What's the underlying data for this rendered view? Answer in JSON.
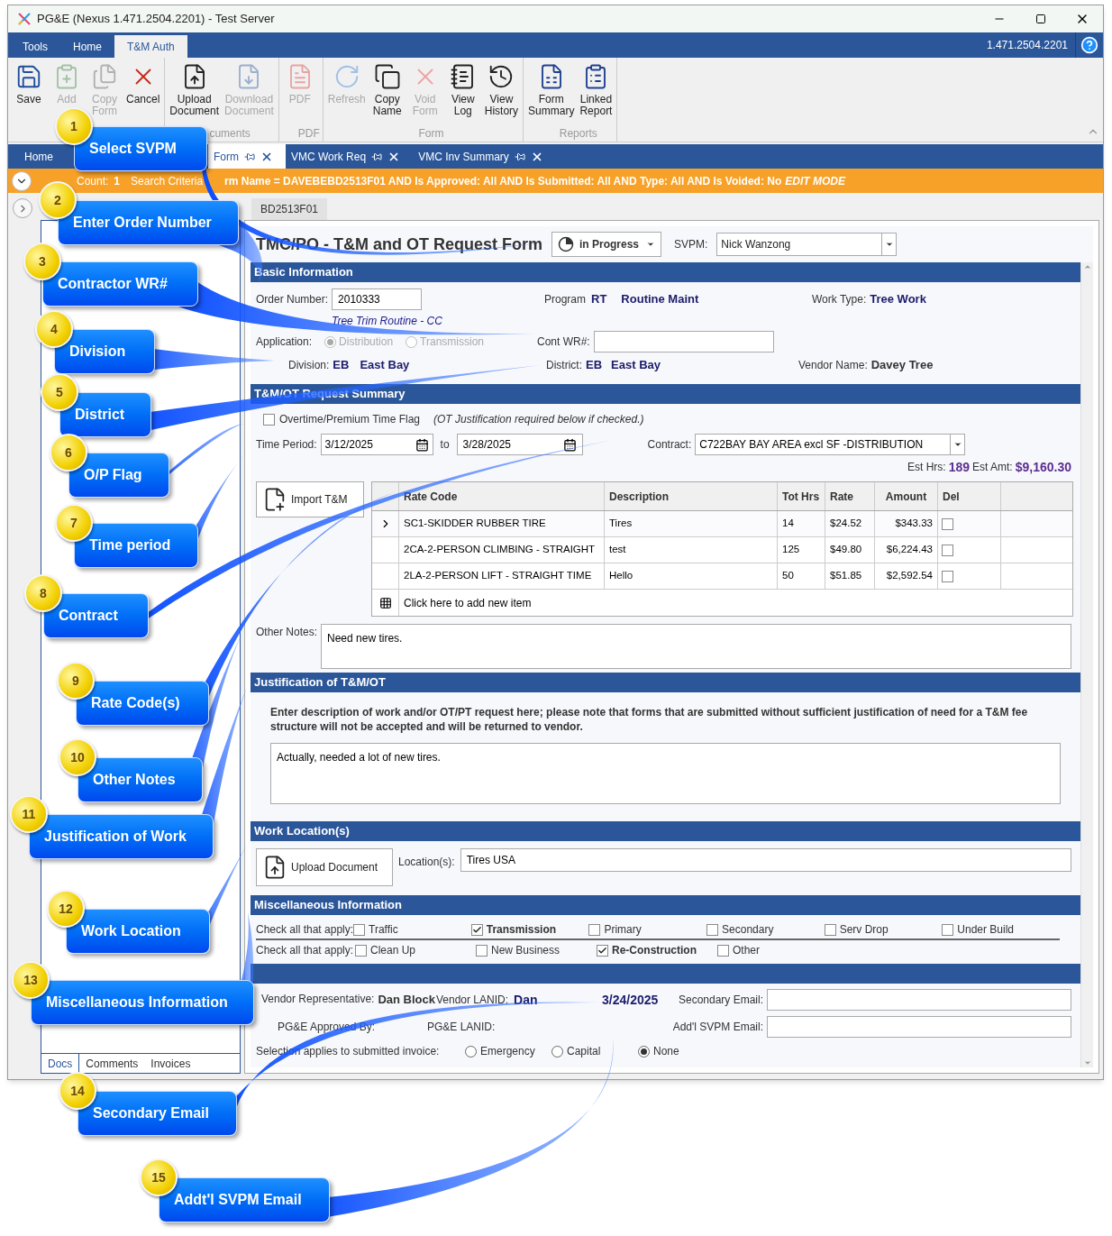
{
  "window": {
    "title": "PG&E (Nexus 1.471.2504.2201) - Test Server"
  },
  "menu_tabs": [
    {
      "label": "Tools",
      "selected": false
    },
    {
      "label": "Home",
      "selected": false
    },
    {
      "label": "T&M Auth",
      "selected": true
    }
  ],
  "version": "1.471.2504.2201",
  "ribbon_groups": [
    {
      "buttons": [
        {
          "kind": "save",
          "label": "Save",
          "disabled": false
        },
        {
          "kind": "add",
          "label": "Add",
          "disabled": true
        },
        {
          "kind": "copy-form",
          "label": "Copy Form",
          "disabled": true
        },
        {
          "kind": "cancel",
          "label": "Cancel",
          "disabled": false
        }
      ]
    },
    {
      "label": "cuments",
      "buttons": [
        {
          "kind": "upload",
          "label": "Upload Document",
          "disabled": false
        },
        {
          "kind": "download",
          "label": "Download Document",
          "disabled": true
        }
      ]
    },
    {
      "label": "PDF",
      "buttons": [
        {
          "kind": "pdf",
          "label": "PDF",
          "disabled": true
        }
      ]
    },
    {
      "label": "Form",
      "buttons": [
        {
          "kind": "refresh",
          "label": "Refresh",
          "disabled": true
        },
        {
          "kind": "copy-name",
          "label": "Copy Name",
          "disabled": false
        },
        {
          "kind": "void",
          "label": "Void Form",
          "disabled": true
        },
        {
          "kind": "log",
          "label": "View Log",
          "disabled": false
        },
        {
          "kind": "history",
          "label": "View History",
          "disabled": false
        }
      ]
    },
    {
      "label": "Reports",
      "buttons": [
        {
          "kind": "summary",
          "label": "Form Summary",
          "disabled": false
        },
        {
          "kind": "report",
          "label": "Linked Report",
          "disabled": false
        }
      ]
    }
  ],
  "doc_tabs": [
    {
      "label": "Home",
      "selected": false,
      "closable": false
    },
    {
      "label": "Form",
      "selected": true,
      "closable": true
    },
    {
      "label": "VMC Work Req",
      "selected": false,
      "closable": true
    },
    {
      "label": "VMC Inv Summary",
      "selected": false,
      "closable": true
    }
  ],
  "filter_bar": {
    "count_label": "Count:",
    "count": "1",
    "criteria_label": "Search Criteria",
    "criteria": "rm Name = DAVEBEBD2513F01 AND Is Approved: All AND Is Submitted: All AND Type: All AND Is Voided: No",
    "mode": "EDIT MODE"
  },
  "side_tabs": [
    {
      "label": "Docs",
      "selected": true
    },
    {
      "label": "Comments",
      "selected": false
    },
    {
      "label": "Invoices",
      "selected": false
    }
  ],
  "form_tab": "BD2513F01",
  "form": {
    "title": "TMC/PO - T&M and OT Request Form",
    "status": "in Progress",
    "svpm_label": "SVPM:",
    "svpm": "Nick Wanzong",
    "basic": {
      "heading": "Basic Information",
      "order_label": "Order Number:",
      "order": "2010333",
      "order_desc": "Tree Trim Routine - CC",
      "program_label": "Program",
      "program_code": "RT",
      "program_name": "Routine Maint",
      "work_type_label": "Work Type:",
      "work_type": "Tree Work",
      "application_label": "Application:",
      "applications": [
        {
          "label": "Distribution",
          "selected": true
        },
        {
          "label": "Transmission",
          "selected": false
        }
      ],
      "cont_wr_label": "Cont WR#:",
      "division_label": "Division:",
      "division_code": "EB",
      "division_name": "East Bay",
      "district_label": "District:",
      "district_code": "EB",
      "district_name": "East Bay",
      "vendor_label": "Vendor Name:",
      "vendor": "Davey Tree"
    },
    "summary": {
      "heading": "T&M/OT Request Summary",
      "ot_flag": {
        "label": "Overtime/Premium Time Flag",
        "checked": false
      },
      "ot_note": "(OT Justification required below if checked.)",
      "time_label": "Time Period:",
      "from": "3/12/2025",
      "to_label": "to",
      "to": "3/28/2025",
      "contract_label": "Contract:",
      "contract": "C722BAY BAY AREA excl SF -DISTRIBUTION",
      "hrs_label": "Est Hrs:",
      "hrs": "189",
      "amt_label": "Est Amt:",
      "amt": "$9,160.30",
      "import_label": "Import T&M",
      "columns": [
        "Rate Code",
        "Description",
        "Tot Hrs",
        "Rate",
        "Amount",
        "Del"
      ],
      "rows": [
        {
          "selected": true,
          "cells": [
            "SC1-SKIDDER RUBBER TIRE",
            "Tires",
            "14",
            "$24.52",
            "$343.33"
          ],
          "del": false
        },
        {
          "selected": false,
          "cells": [
            "2CA-2-PERSON CLIMBING - STRAIGHT",
            "test",
            "125",
            "$49.80",
            "$6,224.43"
          ],
          "del": false
        },
        {
          "selected": false,
          "cells": [
            "2LA-2-PERSON LIFT - STRAIGHT TIME",
            "Hello",
            "50",
            "$51.85",
            "$2,592.54"
          ],
          "del": false
        }
      ],
      "add_row": "Click here to add new item",
      "notes_label": "Other Notes:",
      "notes": "Need new tires."
    },
    "justification": {
      "heading": "Justification of T&M/OT",
      "instructions": "Enter description of work and/or OT/PT request here; please note that forms that are submitted without sufficient justification of need for a T&M fee structure will not be accepted and will be returned to vendor.",
      "text": "Actually, needed a lot of new tires."
    },
    "location": {
      "heading": "Work Location(s)",
      "upload_label": "Upload Document",
      "locations_label": "Location(s):",
      "locations": "Tires USA"
    },
    "misc": {
      "heading": "Miscellaneous Information",
      "rows": [
        {
          "label": "Check all that apply:",
          "items": [
            {
              "label": "Traffic",
              "checked": false
            },
            {
              "label": "Transmission",
              "checked": true
            },
            {
              "label": "Primary",
              "checked": false
            },
            {
              "label": "Secondary",
              "checked": false
            },
            {
              "label": "Serv Drop",
              "checked": false
            },
            {
              "label": "Under Build",
              "checked": false
            }
          ]
        },
        {
          "label": "Check all that apply:",
          "items": [
            {
              "label": "Clean Up",
              "checked": false
            },
            {
              "label": "New Business",
              "checked": false
            },
            {
              "label": "Re-Construction",
              "checked": true
            },
            {
              "label": "Other",
              "checked": false
            }
          ]
        }
      ]
    },
    "approval": {
      "vendor_rep_label": "Vendor Representative:",
      "vendor_rep": "Dan Block",
      "vendor_lanid_label": "Vendor LANID:",
      "vendor_lanid": "Dan",
      "date": "3/24/2025",
      "secondary_email_label": "Secondary Email:",
      "approved_by_label": "PG&E Approved By:",
      "pge_lanid_label": "PG&E LANID:",
      "svpm_email_label": "Add'l SVPM Email:",
      "invoice_label": "Selection applies to submitted invoice:",
      "invoice_options": [
        {
          "label": "Emergency",
          "selected": false
        },
        {
          "label": "Capital",
          "selected": false
        },
        {
          "label": "None",
          "selected": true
        }
      ]
    }
  },
  "callouts": [
    {
      "number": "1",
      "label": "Select SVPM"
    },
    {
      "number": "2",
      "label": "Enter Order Number"
    },
    {
      "number": "3",
      "label": "Contractor WR#"
    },
    {
      "number": "4",
      "label": "Division"
    },
    {
      "number": "5",
      "label": "District"
    },
    {
      "number": "6",
      "label": "O/P Flag"
    },
    {
      "number": "7",
      "label": "Time period"
    },
    {
      "number": "8",
      "label": "Contract"
    },
    {
      "number": "9",
      "label": "Rate Code(s)"
    },
    {
      "number": "10",
      "label": "Other Notes"
    },
    {
      "number": "11",
      "label": "Justification of Work"
    },
    {
      "number": "12",
      "label": "Work Location"
    },
    {
      "number": "13",
      "label": "Miscellaneous Information"
    },
    {
      "number": "14",
      "label": "Secondary Email"
    },
    {
      "number": "15",
      "label": "Addt'l SVPM Email"
    }
  ]
}
